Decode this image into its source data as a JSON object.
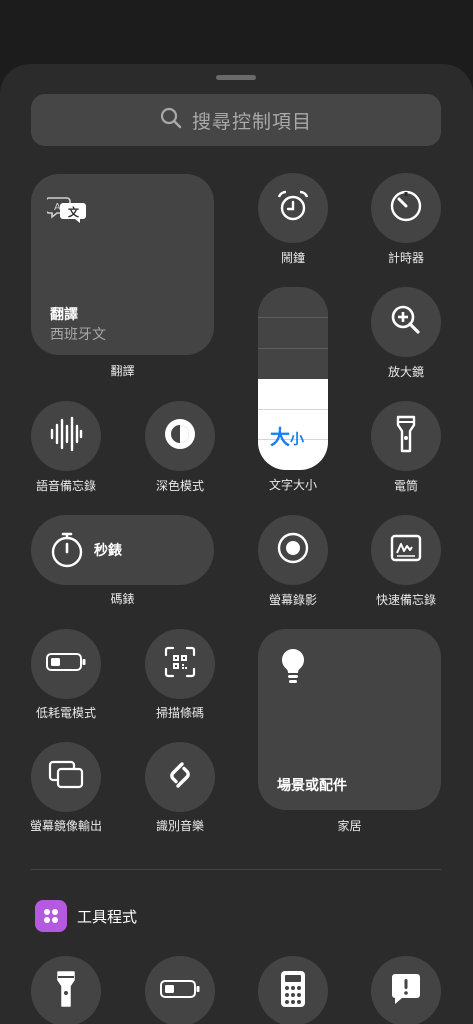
{
  "search": {
    "placeholder": "搜尋控制項目"
  },
  "translate": {
    "title": "翻譯",
    "subtitle": "西班牙文",
    "label": "翻譯"
  },
  "alarm": {
    "label": "鬧鐘"
  },
  "timer": {
    "label": "計時器"
  },
  "magnifier": {
    "label": "放大鏡"
  },
  "text_size": {
    "label": "文字大小",
    "glyph_big": "大",
    "glyph_small": "小"
  },
  "voice_memo": {
    "label": "語音備忘錄"
  },
  "dark_mode": {
    "label": "深色模式"
  },
  "flashlight": {
    "label": "電筒"
  },
  "stopwatch": {
    "title": "秒錶",
    "label": "碼錶"
  },
  "screen_record": {
    "label": "螢幕錄影"
  },
  "quick_note": {
    "label": "快速備忘錄"
  },
  "low_power": {
    "label": "低耗電模式"
  },
  "scan_code": {
    "label": "掃描條碼"
  },
  "home": {
    "title": "場景或配件",
    "label": "家居"
  },
  "screen_mirror": {
    "label": "螢幕鏡像輸出"
  },
  "shazam": {
    "label": "識別音樂"
  },
  "section": {
    "title": "工具程式"
  },
  "colors": {
    "tile": "#434443",
    "sheet": "#2a2b2a",
    "accent": "#b45ae0",
    "text_size_blue": "#1a7df0"
  }
}
